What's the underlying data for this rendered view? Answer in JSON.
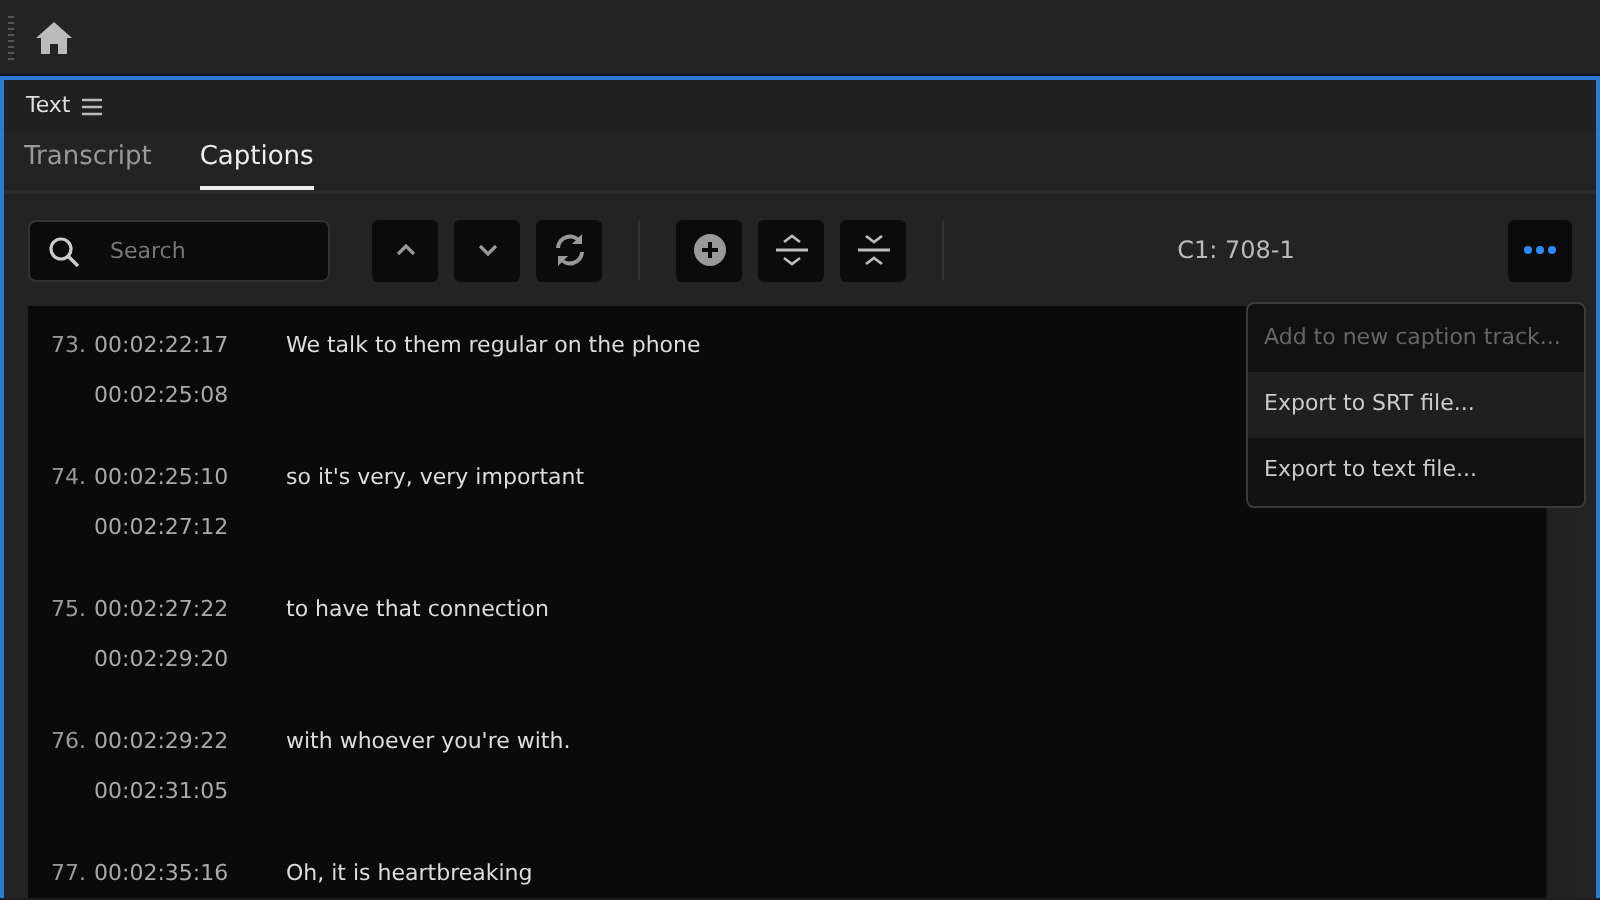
{
  "panel": {
    "title": "Text"
  },
  "tabs": [
    {
      "label": "Transcript",
      "selected": false
    },
    {
      "label": "Captions",
      "selected": true
    }
  ],
  "search": {
    "placeholder": "Search"
  },
  "track_label": "C1: 708-1",
  "menu": [
    {
      "label": "Add to new caption track...",
      "disabled": true,
      "selected": false
    },
    {
      "label": "Export to SRT file...",
      "disabled": false,
      "selected": true
    },
    {
      "label": "Export to text file...",
      "disabled": false,
      "selected": false
    }
  ],
  "captions": [
    {
      "number": "73.",
      "start": "00:02:22:17",
      "end": "00:02:25:08",
      "text": "We talk to them regular on the phone"
    },
    {
      "number": "74.",
      "start": "00:02:25:10",
      "end": "00:02:27:12",
      "text": "so it's very, very important"
    },
    {
      "number": "75.",
      "start": "00:02:27:22",
      "end": "00:02:29:20",
      "text": "to have that connection"
    },
    {
      "number": "76.",
      "start": "00:02:29:22",
      "end": "00:02:31:05",
      "text": "with whoever you're with."
    },
    {
      "number": "77.",
      "start": "00:02:35:16",
      "text": "Oh, it is heartbreaking"
    }
  ]
}
